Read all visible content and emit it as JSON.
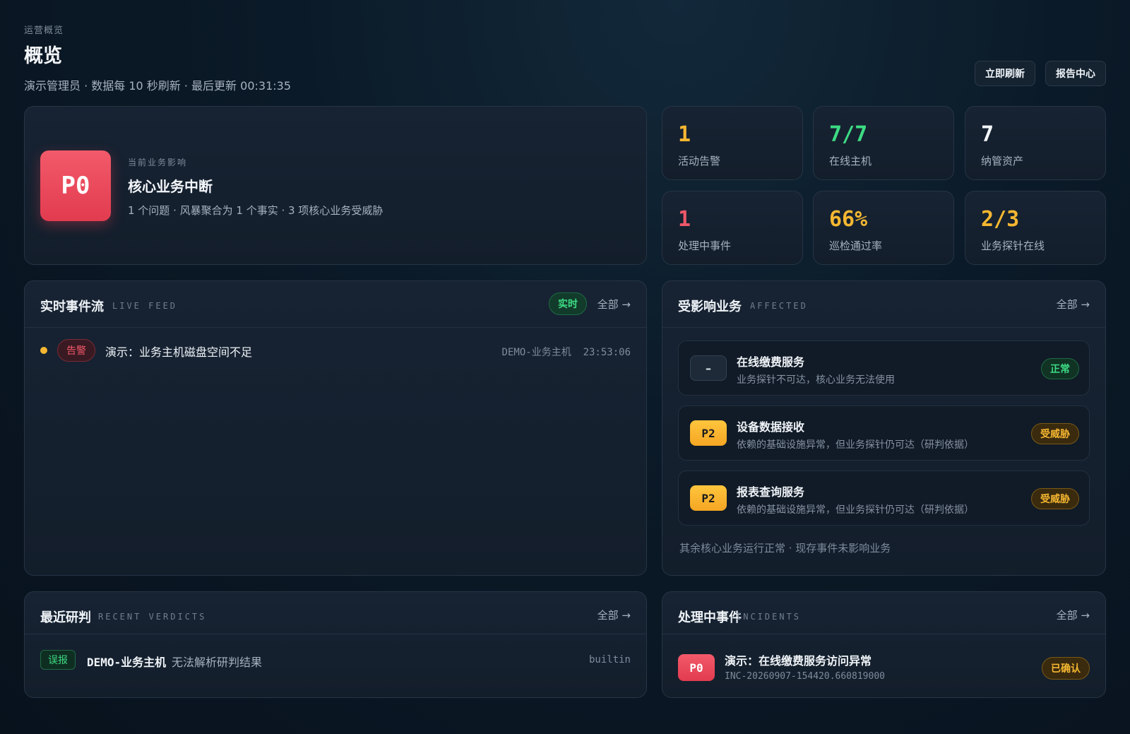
{
  "header": {
    "eyebrow": "运营概览",
    "title": "概览",
    "subtitle": "演示管理员 · 数据每 10 秒刷新 · 最后更新 00:31:35",
    "refresh_label": "立即刷新",
    "report_label": "报告中心"
  },
  "impact": {
    "level": "P0",
    "eyebrow": "当前业务影响",
    "title": "核心业务中断",
    "desc": "1 个问题 · 风暴聚合为 1 个事实 · 3 项核心业务受威胁"
  },
  "stats": [
    {
      "value": "1",
      "label": "活动告警",
      "color": "#f5b731"
    },
    {
      "value": "7/7",
      "label": "在线主机",
      "color": "#3ddc84"
    },
    {
      "value": "7",
      "label": "纳管资产",
      "color": "#f3f6fa"
    },
    {
      "value": "1",
      "label": "处理中事件",
      "color": "#f0576a"
    },
    {
      "value": "66%",
      "label": "巡检通过率",
      "color": "#f5b731"
    },
    {
      "value": "2/3",
      "label": "业务探针在线",
      "color": "#f5b731"
    }
  ],
  "feed": {
    "title": "实时事件流",
    "subtitle": "LIVE FEED",
    "live_label": "实时",
    "all_label": "全部 →",
    "items": [
      {
        "tag": "告警",
        "title": "演示：业务主机磁盘空间不足",
        "host": "DEMO-业务主机",
        "time": "23:53:06"
      }
    ]
  },
  "affected": {
    "title": "受影响业务",
    "subtitle": "AFFECTED",
    "all_label": "全部 →",
    "services": [
      {
        "icon": "–",
        "name": "在线缴费服务",
        "desc": "业务探针不可达，核心业务无法使用",
        "status": "正常"
      },
      {
        "icon": "P2",
        "name": "设备数据接收",
        "desc": "依赖的基础设施异常，但业务探针仍可达（研判依据）",
        "status": "受威胁"
      },
      {
        "icon": "P2",
        "name": "报表查询服务",
        "desc": "依赖的基础设施异常，但业务探针仍可达（研判依据）",
        "status": "受威胁"
      }
    ],
    "note": "其余核心业务运行正常 · 现存事件未影响业务"
  },
  "verdicts": {
    "title": "最近研判",
    "subtitle": "RECENT VERDICTS",
    "all_label": "全部 →",
    "items": [
      {
        "tag": "误报",
        "host": "DEMO-业务主机",
        "message": "无法解析研判结果",
        "source": "builtin"
      }
    ]
  },
  "incidents": {
    "title": "处理中事件",
    "subtitle": "INCIDENTS",
    "all_label": "全部 →",
    "items": [
      {
        "level": "P0",
        "title": "演示：在线缴费服务访问异常",
        "id": "INC-20260907-154420.660819000",
        "status": "已确认"
      }
    ]
  }
}
